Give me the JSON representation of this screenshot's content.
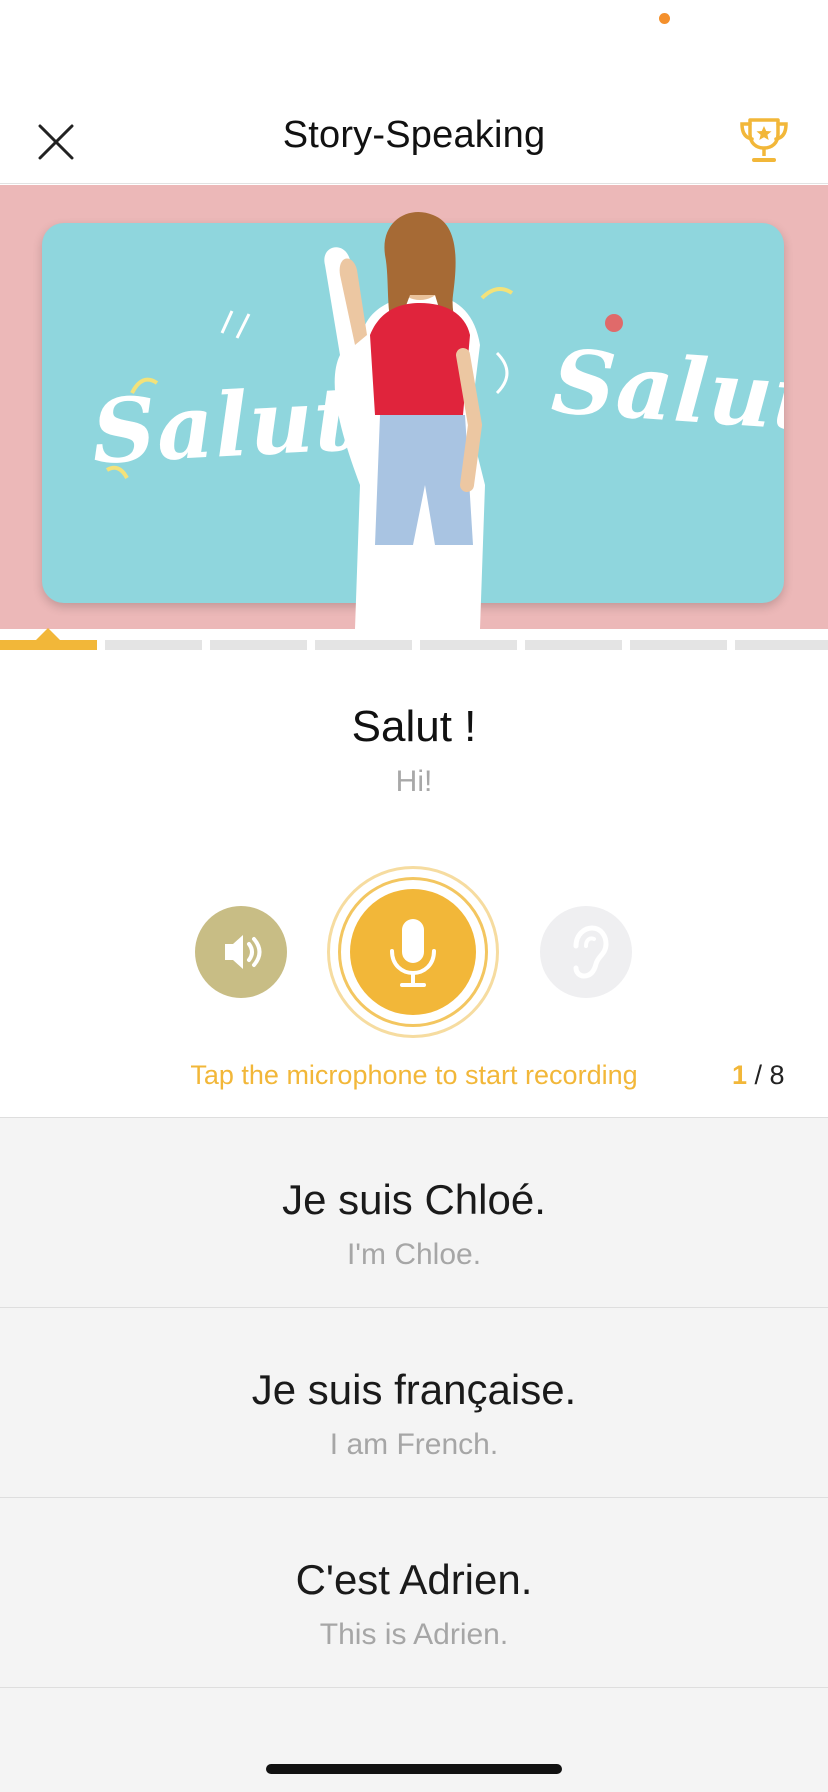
{
  "header": {
    "title": "Story-Speaking"
  },
  "hero": {
    "left_word": "Salut",
    "right_word": "Salut"
  },
  "progress": {
    "current": 1,
    "total": 8
  },
  "current": {
    "sentence": "Salut !",
    "translation": "Hi!"
  },
  "controls": {
    "hint": "Tap the microphone to start recording",
    "counter_current": "1",
    "counter_total": "/ 8"
  },
  "sentences": [
    {
      "fr": "Je suis Chloé.",
      "en": "I'm Chloe."
    },
    {
      "fr": "Je suis française.",
      "en": "I am French."
    },
    {
      "fr": "C'est Adrien.",
      "en": "This is Adrien."
    }
  ],
  "colors": {
    "accent": "#f2b739",
    "speaker": "#c8bd85",
    "hero_background": "#ecb8b8",
    "hero_card": "#8fd6dd",
    "shirt": "#e0243c"
  },
  "icons": {
    "close": "close-icon",
    "trophy": "trophy-icon",
    "speaker": "speaker-icon",
    "microphone": "microphone-icon",
    "ear": "ear-icon"
  }
}
